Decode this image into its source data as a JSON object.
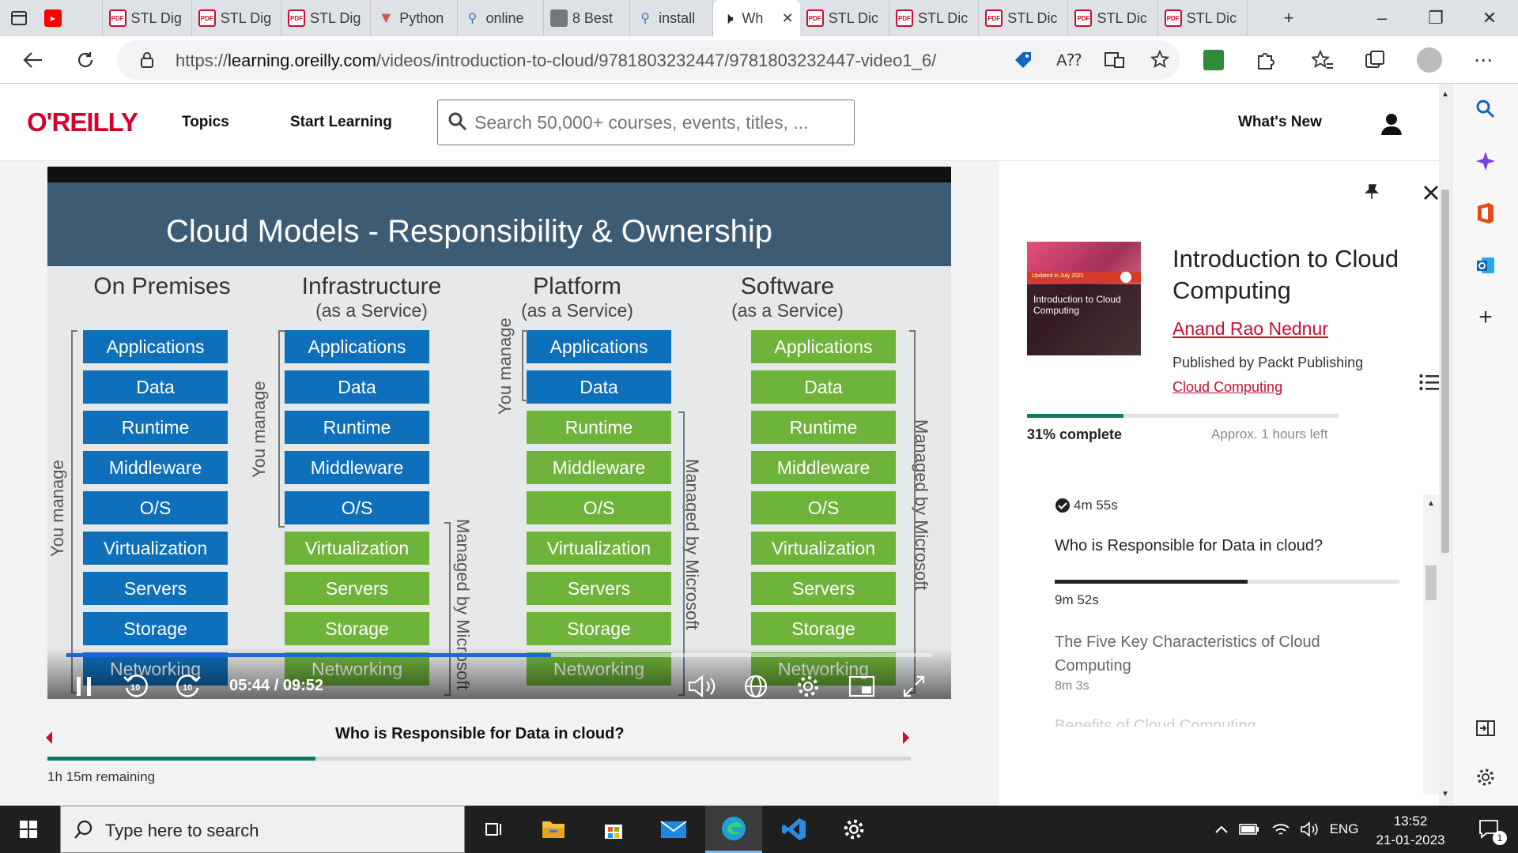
{
  "browser": {
    "tabs": [
      {
        "label": "",
        "icon": "youtube-icon"
      },
      {
        "label": "STL Dig",
        "icon": "pdf-icon"
      },
      {
        "label": "STL Dig",
        "icon": "pdf-icon"
      },
      {
        "label": "STL Dig",
        "icon": "pdf-icon"
      },
      {
        "label": "Python",
        "icon": "vue-icon"
      },
      {
        "label": "online",
        "icon": "search-icon"
      },
      {
        "label": "8 Best",
        "icon": "foss-icon"
      },
      {
        "label": "install",
        "icon": "search-icon"
      },
      {
        "label": "Wh",
        "icon": "speaker-icon"
      },
      {
        "label": "STL Dic",
        "icon": "pdf-icon"
      },
      {
        "label": "STL Dic",
        "icon": "pdf-icon"
      },
      {
        "label": "STL Dic",
        "icon": "pdf-icon"
      },
      {
        "label": "STL Dic",
        "icon": "pdf-icon"
      },
      {
        "label": "STL Dic",
        "icon": "pdf-icon"
      }
    ],
    "url_prefix": "https://",
    "url_host": "learning.oreilly.com",
    "url_path": "/videos/introduction-to-cloud/9781803232447/9781803232447-video1_6/"
  },
  "site": {
    "logo": "O'REILLY",
    "nav_topics": "Topics",
    "nav_start": "Start Learning",
    "search_placeholder": "Search 50,000+ courses, events, titles, ...",
    "whats_new": "What's New"
  },
  "slide": {
    "title": "Cloud Models -  Responsibility & Ownership",
    "columns": [
      {
        "head": "On Premises",
        "sub": ""
      },
      {
        "head": "Infrastructure",
        "sub": "(as a Service)"
      },
      {
        "head": "Platform",
        "sub": "(as a Service)"
      },
      {
        "head": "Software",
        "sub": "(as a Service)"
      }
    ],
    "layers": [
      "Applications",
      "Data",
      "Runtime",
      "Middleware",
      "O/S",
      "Virtualization",
      "Servers",
      "Storage",
      "Networking"
    ],
    "you_manage": "You manage",
    "managed_by": "Managed by Microsoft"
  },
  "player": {
    "time": "05:44 / 09:52",
    "progress_fraction": 0.56,
    "video_title": "Who is Responsible for Data in cloud?",
    "course_progress_fraction": 0.31,
    "remaining": "1h 15m remaining"
  },
  "panel": {
    "cover_text": "Introduction to Cloud Computing",
    "cover_badge": "Updated in July 2021",
    "title": "Introduction to Cloud Computing",
    "author": "Anand Rao Nednur",
    "publisher": "Published by Packt Publishing",
    "topic": "Cloud Computing",
    "percent": "31% complete",
    "approx": "Approx. 1 hours left",
    "toc": [
      {
        "duration": "4m 55s"
      },
      {
        "title": "Who is Responsible for Data in cloud?"
      },
      {
        "duration": "9m 52s"
      },
      {
        "title": "The Five Key Characteristics of Cloud Computing",
        "duration": "8m 3s"
      },
      {
        "title": "Benefits of Cloud Computing"
      }
    ]
  },
  "taskbar": {
    "search": "Type here to search",
    "lang": "ENG",
    "time": "13:52",
    "date": "21-01-2023",
    "notif": "1"
  },
  "colors": {
    "brand": "#d3002d",
    "blue": "#0e6fba",
    "green": "#6fb43a",
    "teal": "#0d7a66"
  }
}
